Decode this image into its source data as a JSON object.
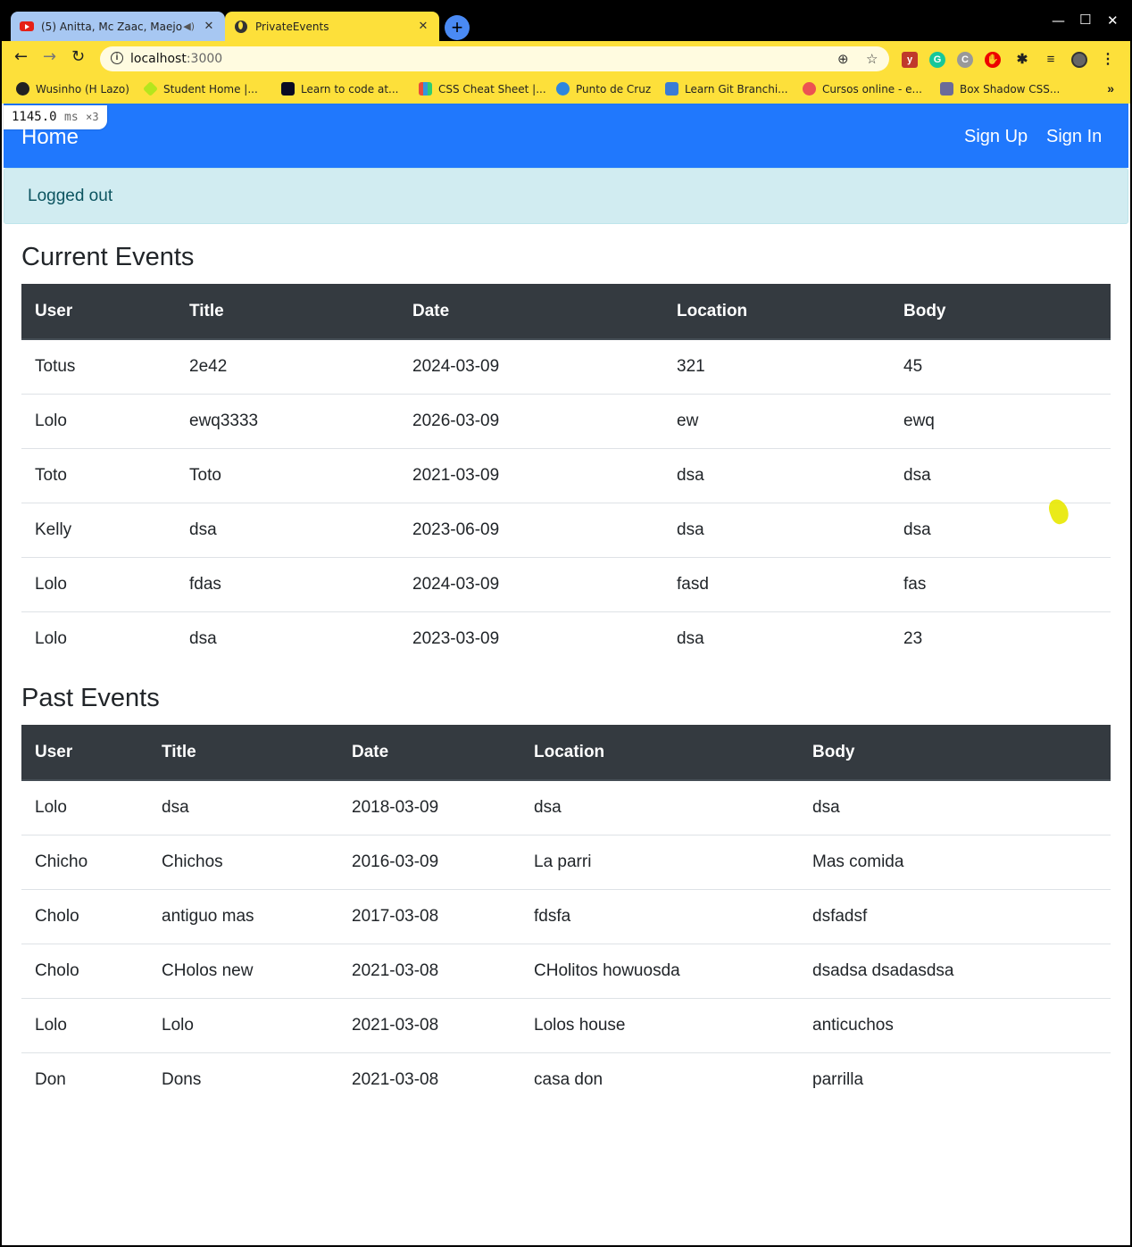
{
  "browser": {
    "tabs": [
      {
        "title": "(5) Anitta, Mc Zaac, Maejor",
        "favicon": "youtube-icon",
        "active": false
      },
      {
        "title": "PrivateEvents",
        "favicon": "globe-icon",
        "active": true
      }
    ],
    "address": {
      "host": "localhost",
      "port": ":3000"
    },
    "bookmarks": [
      {
        "label": "Wusinho (H Lazo)"
      },
      {
        "label": "Student Home |..."
      },
      {
        "label": "Learn to code at..."
      },
      {
        "label": "CSS Cheat Sheet |..."
      },
      {
        "label": "Punto de Cruz"
      },
      {
        "label": "Learn Git Branchi..."
      },
      {
        "label": "Cursos online - e..."
      },
      {
        "label": "Box Shadow CSS..."
      }
    ]
  },
  "perf": {
    "value": "1145.0",
    "unit": "ms",
    "multiplier": "×3"
  },
  "navbar": {
    "brand": "Home",
    "sign_up": "Sign Up",
    "sign_in": "Sign In"
  },
  "alert": {
    "message": "Logged out"
  },
  "current": {
    "title": "Current Events",
    "headers": [
      "User",
      "Title",
      "Date",
      "Location",
      "Body"
    ],
    "rows": [
      [
        "Totus",
        "2e42",
        "2024-03-09",
        "321",
        "45"
      ],
      [
        "Lolo",
        "ewq3333",
        "2026-03-09",
        "ew",
        "ewq"
      ],
      [
        "Toto",
        "Toto",
        "2021-03-09",
        "dsa",
        "dsa"
      ],
      [
        "Kelly",
        "dsa",
        "2023-06-09",
        "dsa",
        "dsa"
      ],
      [
        "Lolo",
        "fdas",
        "2024-03-09",
        "fasd",
        "fas"
      ],
      [
        "Lolo",
        "dsa",
        "2023-03-09",
        "dsa",
        "23"
      ]
    ]
  },
  "past": {
    "title": "Past Events",
    "headers": [
      "User",
      "Title",
      "Date",
      "Location",
      "Body"
    ],
    "rows": [
      [
        "Lolo",
        "dsa",
        "2018-03-09",
        "dsa",
        "dsa"
      ],
      [
        "Chicho",
        "Chichos",
        "2016-03-09",
        "La parri",
        "Mas comida"
      ],
      [
        "Cholo",
        "antiguo mas",
        "2017-03-08",
        "fdsfa",
        "dsfadsf"
      ],
      [
        "Cholo",
        "CHolos new",
        "2021-03-08",
        "CHolitos howuosda",
        "dsadsa dsadasdsa"
      ],
      [
        "Lolo",
        "Lolo",
        "2021-03-08",
        "Lolos house",
        "anticuchos"
      ],
      [
        "Don",
        "Dons",
        "2021-03-08",
        "casa don",
        "parrilla"
      ]
    ]
  }
}
